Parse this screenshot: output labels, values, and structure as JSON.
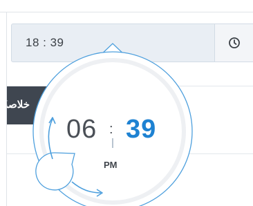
{
  "time_field": {
    "value": "18 : 39"
  },
  "side_label": {
    "text": "خلاصةُ"
  },
  "time_picker": {
    "hours": "06",
    "separator": ":",
    "minutes": "39",
    "period": "PM"
  },
  "icons": {
    "clock": "clock-icon"
  },
  "colors": {
    "accent": "#1e82d2",
    "field_bg": "#e9eef4",
    "label_bg": "#3f4650"
  }
}
